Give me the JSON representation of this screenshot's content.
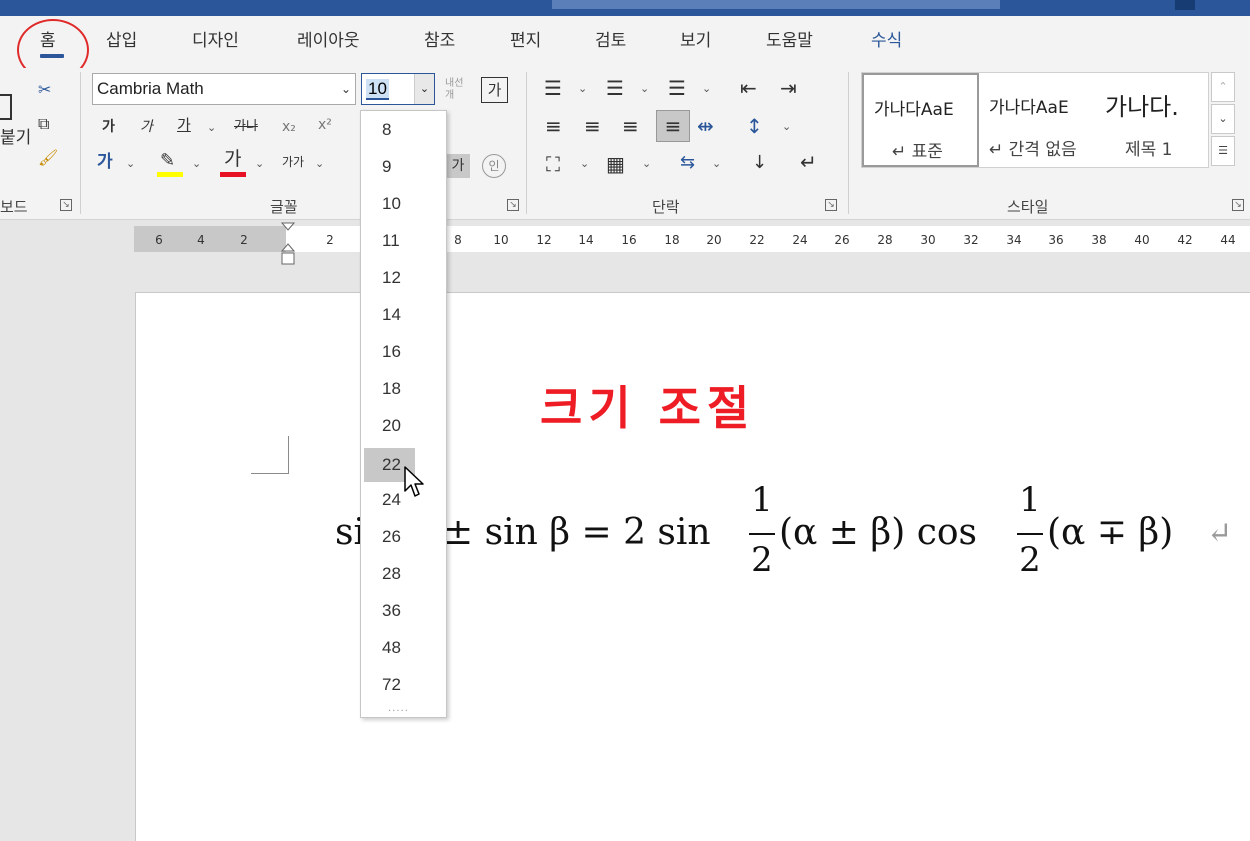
{
  "ribbon_tabs": [
    "홈",
    "삽입",
    "디자인",
    "레이아웃",
    "참조",
    "편지",
    "검토",
    "보기",
    "도움말",
    "수식"
  ],
  "clipboard": {
    "label_fragment": "붙기",
    "group_label": "보드"
  },
  "font_group": {
    "font_name": "Cambria Math",
    "font_size": "10",
    "grow_shrink_hint": "내선 개",
    "char_border_label": "가",
    "bold": "가",
    "italic": "가",
    "underline": "가",
    "strike": "가나",
    "subscript": "x₂",
    "superscript": "x²",
    "font_color_label": "가",
    "char_spacing_label": "가가",
    "shade_label": "가",
    "enclose_label": "인",
    "effects_label": "가",
    "group_label": "글꼴"
  },
  "paragraph_group": {
    "group_label": "단락"
  },
  "styles_group": {
    "tiles": [
      {
        "preview": "가나다AaE",
        "name": "↵ 표준"
      },
      {
        "preview": "가나다AaE",
        "name": "↵ 간격 없음"
      },
      {
        "preview": "가나다.",
        "name": "제목 1"
      }
    ],
    "group_label": "스타일"
  },
  "ruler": {
    "left_labels": [
      "6",
      "4",
      "2"
    ],
    "right_labels": [
      "2",
      "8",
      "10",
      "12",
      "14",
      "16",
      "18",
      "20",
      "22",
      "24",
      "26",
      "28",
      "30",
      "32",
      "34",
      "36",
      "38",
      "40",
      "42",
      "44"
    ]
  },
  "font_size_dropdown": {
    "options": [
      "8",
      "9",
      "10",
      "11",
      "12",
      "14",
      "16",
      "18",
      "20",
      "22",
      "24",
      "26",
      "28",
      "36",
      "48",
      "72"
    ],
    "highlighted": "22",
    "more": "....."
  },
  "document": {
    "annotation": "크기 조절",
    "equation": {
      "part1": "si",
      "part2": "± sin β = 2 sin",
      "frac_num": "1",
      "frac_den": "2",
      "part3": "(α ± β) cos",
      "part4": "(α ∓ β)",
      "para_mark": "↵"
    }
  },
  "colors": {
    "accent": "#2b579a",
    "annotation_red": "#ee1c25",
    "highlight_yellow": "#ffff00",
    "font_red": "#e81123"
  }
}
